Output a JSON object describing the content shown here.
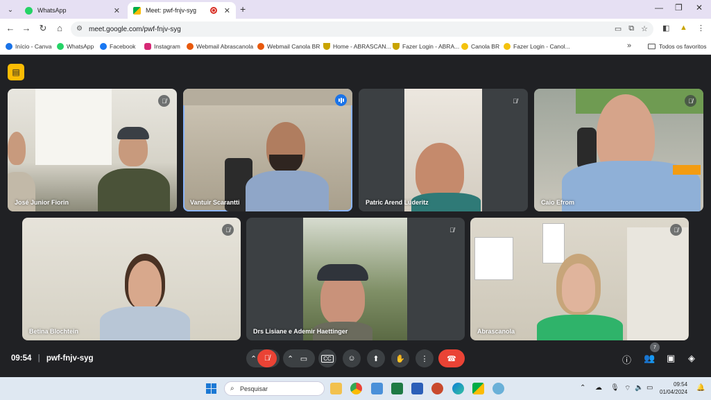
{
  "browser": {
    "tabs": [
      {
        "title": "WhatsApp",
        "icon": "whatsapp-icon",
        "color": "#25d366"
      },
      {
        "title": "Meet: pwf-fnjv-syg",
        "icon": "meet-icon",
        "color": "#00ac47"
      }
    ],
    "url": "meet.google.com/pwf-fnjv-syg",
    "bookmarks": [
      {
        "label": "Início - Canva",
        "icon": "canva-icon",
        "color": "#1a73e8"
      },
      {
        "label": "WhatsApp",
        "icon": "whatsapp-icon",
        "color": "#25d366"
      },
      {
        "label": "Facebook",
        "icon": "facebook-icon",
        "color": "#1877f2"
      },
      {
        "label": "Instagram",
        "icon": "instagram-icon",
        "color": "#d62976"
      },
      {
        "label": "Webmail Abrascanola",
        "icon": "webmail-icon",
        "color": "#e8590c"
      },
      {
        "label": "Webmail Canola BR",
        "icon": "webmail-icon",
        "color": "#e8590c"
      },
      {
        "label": "Home - ABRASCAN...",
        "icon": "abrascanola-icon",
        "color": "#c9a400"
      },
      {
        "label": "Fazer Login - ABRA...",
        "icon": "abrascanola-icon",
        "color": "#c9a400"
      },
      {
        "label": "Canola BR",
        "icon": "canola-icon",
        "color": "#f4c20d"
      },
      {
        "label": "Fazer Login - Canol...",
        "icon": "canola-icon",
        "color": "#f4c20d"
      }
    ],
    "all_bookmarks_label": "Todos os favoritos"
  },
  "meet": {
    "participants": [
      {
        "name": "José Junior Fiorin",
        "muted": true
      },
      {
        "name": "Vantuir Scarantti",
        "muted": false,
        "speaking": true
      },
      {
        "name": "Patric Arend Lüderitz",
        "muted": true
      },
      {
        "name": "Caio Efrom",
        "muted": true
      },
      {
        "name": "Betina Blochtein",
        "muted": true
      },
      {
        "name": "Drs Lisiane e Ademir Haettinger",
        "muted": true
      },
      {
        "name": "Abrascanola",
        "muted": true
      }
    ],
    "time": "09:54",
    "separator": "|",
    "meeting_code": "pwf-fnjv-syg",
    "people_count": "7",
    "end_call_color": "#ea4335"
  },
  "taskbar": {
    "search_placeholder": "Pesquisar",
    "time": "09:54",
    "date": "01/04/2024"
  }
}
